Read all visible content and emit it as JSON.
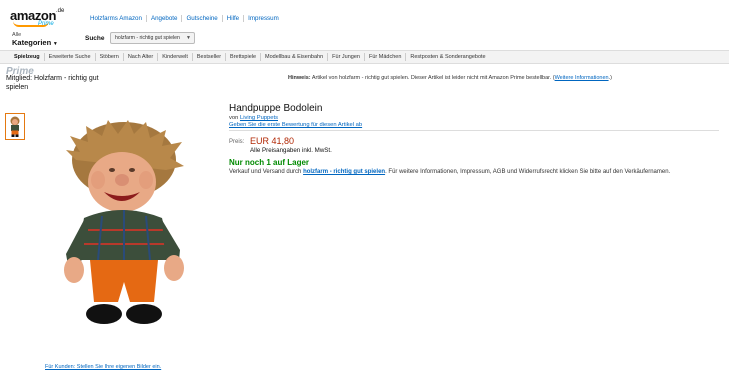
{
  "header": {
    "logo_word": "amazon",
    "logo_tld": ".de",
    "logo_prime": "Prime",
    "nav": [
      "Holzfarms Amazon",
      "Angebote",
      "Gutscheine",
      "Hilfe",
      "Impressum"
    ],
    "all_label": "Alle",
    "categories_label": "Kategorien",
    "search_label": "Suche",
    "search_scope": "holzfarm - richtig gut spielen"
  },
  "subnav": [
    "Spielzeug",
    "Erweiterte Suche",
    "Stöbern",
    "Nach Alter",
    "Kinderwelt",
    "Bestseller",
    "Brettspiele",
    "Modellbau & Eisenbahn",
    "Für Jungen",
    "Für Mädchen",
    "Restposten & Sonderangebote"
  ],
  "prime": {
    "word": "Prime",
    "member_text": "Mitglied:  Holzfarm - richtig gut spielen",
    "hint_label": "Hinweis:",
    "hint_text": " Artikel von holzfarm - richtig gut spielen. Dieser Artikel ist leider nicht mit Amazon Prime bestellbar. (",
    "hint_link": "Weitere Informationen",
    "hint_end": ".)"
  },
  "product": {
    "title": "Handpuppe Bodolein",
    "by_prefix": "von ",
    "brand": "Living Puppets",
    "review_link": "Geben Sie die erste Bewertung für diesen Artikel ab",
    "price_label": "Preis:",
    "price": "EUR 41,80",
    "vat_note": "Alle Preisangaben inkl. MwSt.",
    "stock": "Nur noch 1 auf Lager",
    "ship_prefix": "Verkauf und Versand durch ",
    "seller": "holzfarm - richtig gut spielen",
    "ship_suffix": ". Für weitere Informationen, Impressum, AGB und Widerrufsrecht klicken Sie bitte auf den Verkäufernamen."
  },
  "images": {
    "customer_upload_link": "Für Kunden: Stellen Sie Ihre eigenen Bilder ein."
  }
}
